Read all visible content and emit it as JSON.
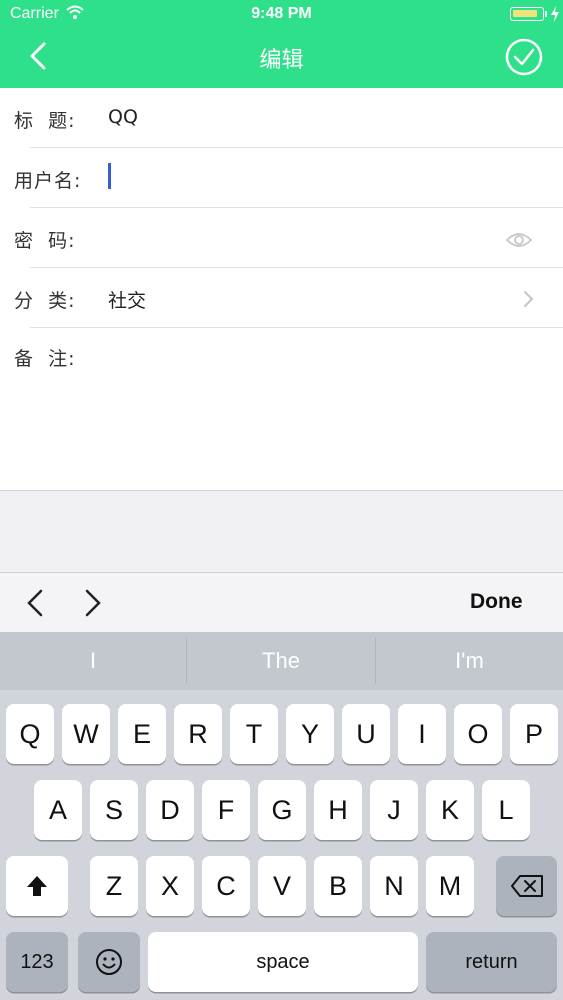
{
  "status_bar": {
    "carrier": "Carrier",
    "time": "9:48 PM",
    "wifi_icon": "wifi-icon",
    "battery_level": 0.85
  },
  "nav": {
    "title": "编辑",
    "back_icon": "chevron-left-icon",
    "done_icon": "check-circle-icon",
    "bar_color": "#2fe08a"
  },
  "form": {
    "title_label": "标  题:",
    "title_value": "QQ",
    "username_label": "用户名:",
    "username_value": "",
    "password_label": "密  码:",
    "password_value": "",
    "category_label": "分  类:",
    "category_value": "社交",
    "notes_label": "备  注:",
    "notes_value": ""
  },
  "toolbar": {
    "done_label": "Done"
  },
  "keyboard": {
    "suggestions": [
      "I",
      "The",
      "I'm"
    ],
    "row1": [
      "Q",
      "W",
      "E",
      "R",
      "T",
      "Y",
      "U",
      "I",
      "O",
      "P"
    ],
    "row2": [
      "A",
      "S",
      "D",
      "F",
      "G",
      "H",
      "J",
      "K",
      "L"
    ],
    "row3": [
      "Z",
      "X",
      "C",
      "V",
      "B",
      "N",
      "M"
    ],
    "numbers_label": "123",
    "space_label": "space",
    "return_label": "return"
  }
}
